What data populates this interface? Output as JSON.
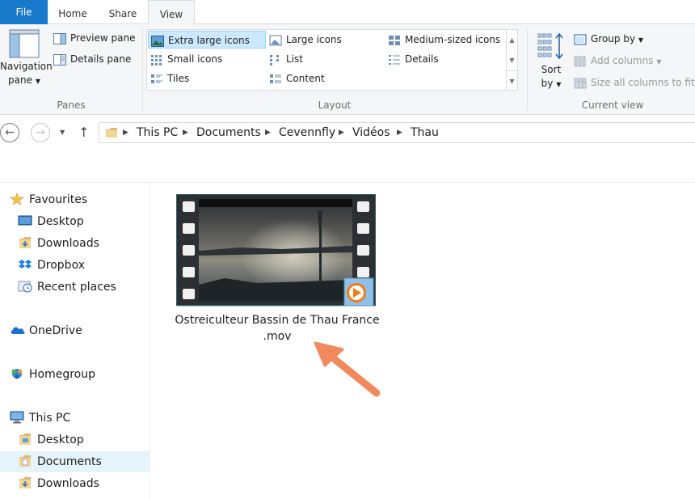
{
  "tabs": {
    "file": "File",
    "home": "Home",
    "share": "Share",
    "view": "View"
  },
  "panes": {
    "navigation_pane_line1": "Navigation",
    "navigation_pane_line2": "pane",
    "preview_pane": "Preview pane",
    "details_pane": "Details pane",
    "label": "Panes"
  },
  "layout": {
    "extra_large_icons": "Extra large icons",
    "large_icons": "Large icons",
    "medium_icons": "Medium-sized icons",
    "small_icons": "Small icons",
    "list": "List",
    "details": "Details",
    "tiles": "Tiles",
    "content": "Content",
    "label": "Layout"
  },
  "current_view": {
    "sort_line1": "Sort",
    "sort_line2": "by",
    "group_by": "Group by",
    "add_columns": "Add columns",
    "size_columns": "Size all columns to fit",
    "label": "Current view"
  },
  "breadcrumb": [
    "This PC",
    "Documents",
    "Cevennfly",
    "Vidéos",
    "Thau"
  ],
  "nav": {
    "favourites": "Favourites",
    "desktop": "Desktop",
    "downloads": "Downloads",
    "dropbox": "Dropbox",
    "recent_places": "Recent places",
    "onedrive": "OneDrive",
    "homegroup": "Homegroup",
    "this_pc": "This PC",
    "pc_desktop": "Desktop",
    "pc_documents": "Documents",
    "pc_downloads": "Downloads"
  },
  "file": {
    "name_line1": "Ostreiculteur Bassin de Thau France",
    "name_line2": ".mov"
  },
  "colors": {
    "accent": "#1979ca",
    "selection": "#cce8ff",
    "arrow": "#f08a5d"
  }
}
